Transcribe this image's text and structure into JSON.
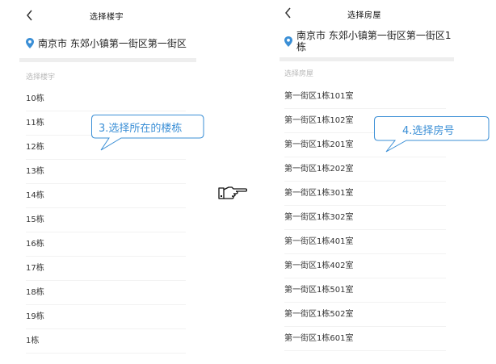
{
  "left": {
    "title": "选择楼宇",
    "location": "南京市 东郊小镇第一街区第一街区",
    "section_label": "选择楼宇",
    "items": [
      "10栋",
      "11栋",
      "12栋",
      "13栋",
      "14栋",
      "15栋",
      "16栋",
      "17栋",
      "18栋",
      "19栋",
      "1栋"
    ],
    "callout": "3.选择所在的楼栋"
  },
  "right": {
    "title": "选择房屋",
    "location_line1": "南京市 东郊小镇第一街区第一街区1",
    "location_line2": "栋",
    "section_label": "选择房屋",
    "items": [
      "第一街区1栋101室",
      "第一街区1栋102室",
      "第一街区1栋201室",
      "第一街区1栋202室",
      "第一街区1栋301室",
      "第一街区1栋302室",
      "第一街区1栋401室",
      "第一街区1栋402室",
      "第一街区1栋501室",
      "第一街区1栋502室",
      "第一街区1栋601室"
    ],
    "callout": "4.选择房号"
  },
  "colors": {
    "accent": "#3b8fd6",
    "location_pin": "#3b8fd6",
    "divider": "#eeeeee",
    "section_label": "#b8b8b8"
  },
  "icons": {
    "back": "chevron-left-icon",
    "location": "location-pin-icon",
    "pointer": "pointing-hand-icon"
  }
}
